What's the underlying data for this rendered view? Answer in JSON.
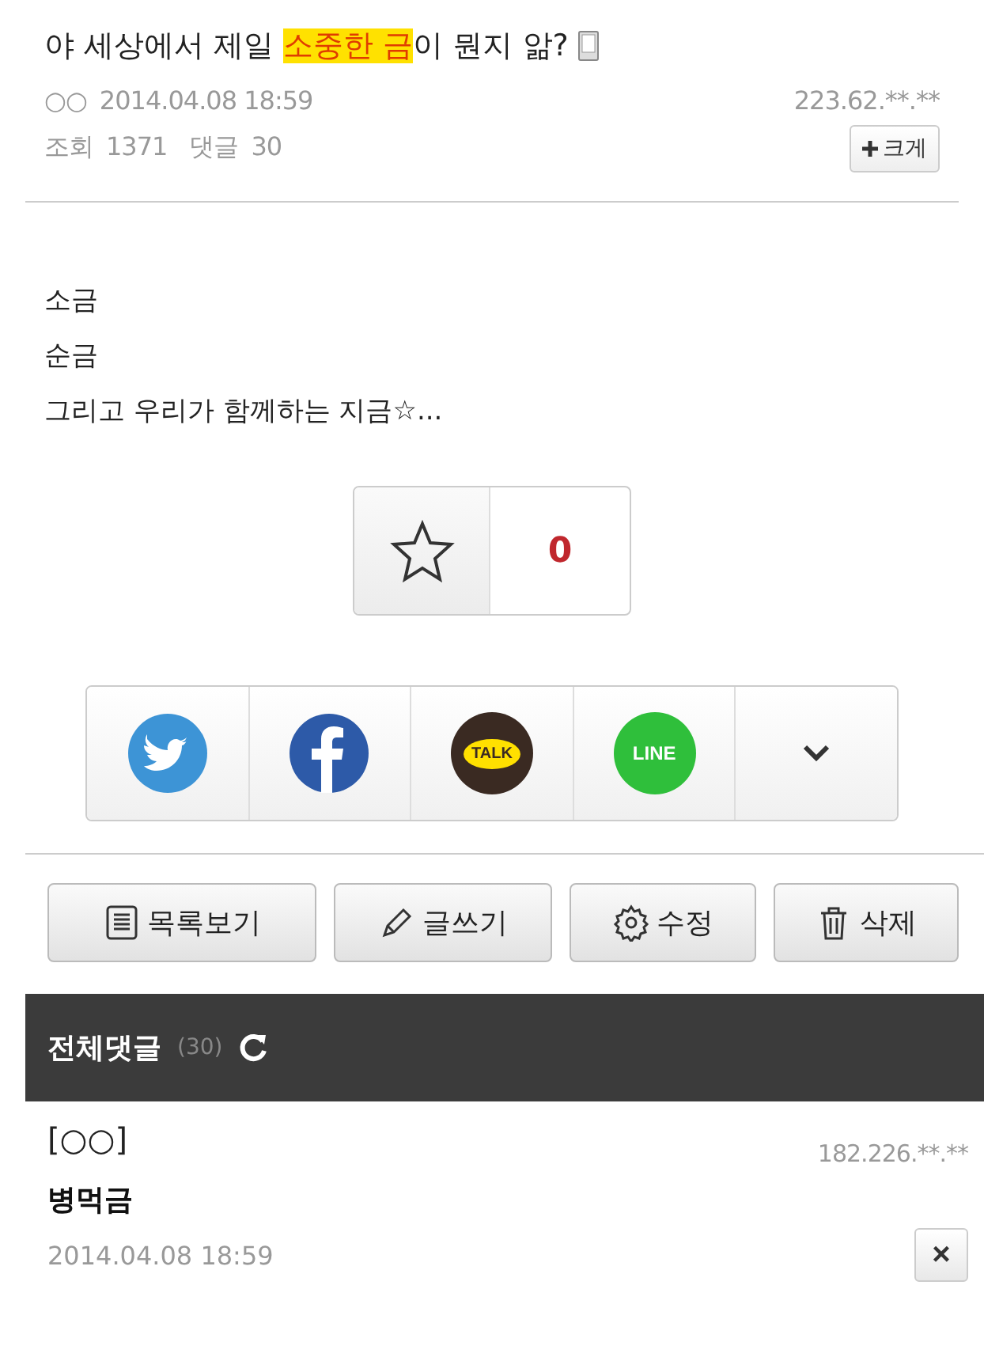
{
  "post": {
    "title_parts": [
      {
        "text": "야 세상에서 제일 ",
        "highlighted": false
      },
      {
        "text": "소중한 금",
        "highlighted": true
      },
      {
        "text": "이 뭔지 앎?",
        "highlighted": false
      }
    ],
    "author": "○○",
    "date": "2014.04.08 18:59",
    "ip": "223.62.**.**",
    "views_label": "조회",
    "views": "1371",
    "comments_label": "댓글",
    "comments": "30",
    "enlarge_button": "크게",
    "body_lines": [
      "소금",
      "순금",
      "그리고 우리가 함께하는 지금☆..."
    ]
  },
  "recommend": {
    "count": "0"
  },
  "share": [
    {
      "kind": "twitter"
    },
    {
      "kind": "facebook"
    },
    {
      "kind": "kakao",
      "badge_text": "TALK"
    },
    {
      "kind": "line",
      "badge_text": "LINE"
    },
    {
      "kind": "more"
    }
  ],
  "actions": [
    {
      "kind": "list",
      "label": "목록보기"
    },
    {
      "kind": "write",
      "label": "글쓰기"
    },
    {
      "kind": "edit",
      "label": "수정"
    },
    {
      "kind": "delete",
      "label": "삭제"
    }
  ],
  "comments_header": {
    "title": "전체댓글",
    "count": "(30)"
  },
  "comments": [
    {
      "author": "[○○]",
      "ip": "182.226.**.**",
      "text": "병먹금",
      "date": "2014.04.08 18:59",
      "close": "×"
    }
  ]
}
